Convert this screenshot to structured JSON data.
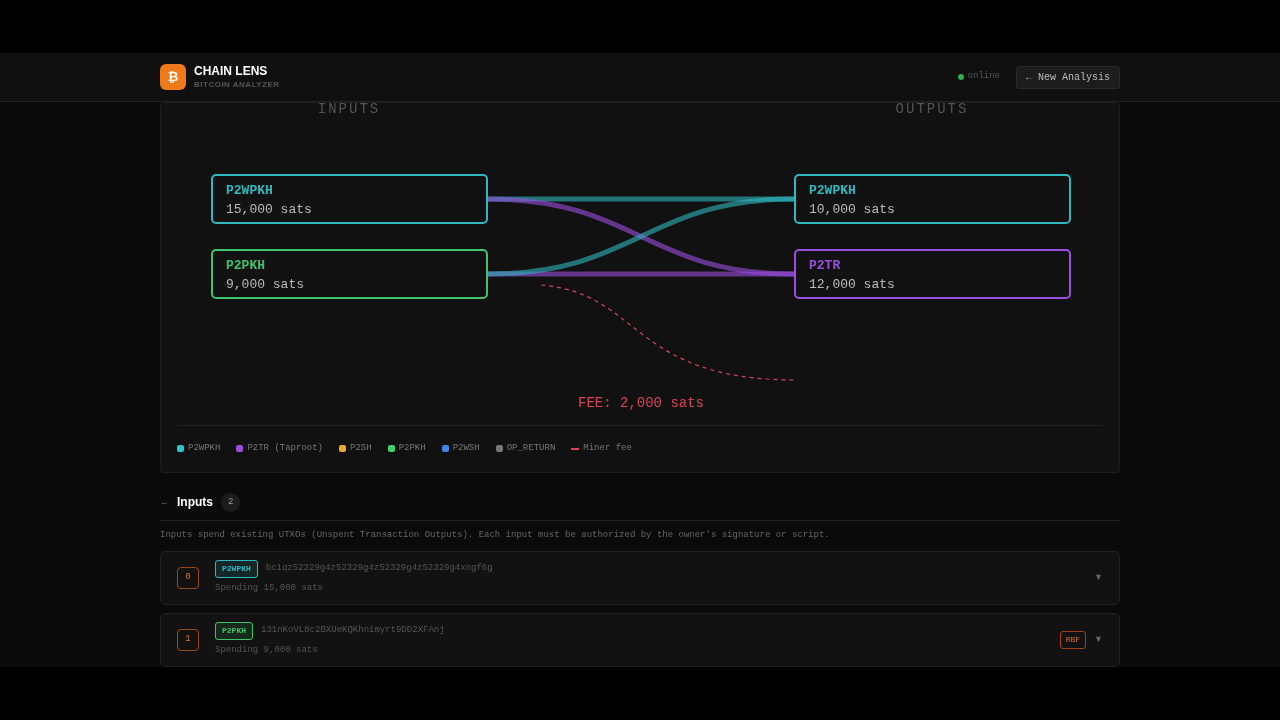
{
  "header": {
    "logo_glyph": "₿",
    "title": "CHAIN LENS",
    "subtitle": "BITCOIN ANALYZER",
    "status": {
      "label": "online",
      "online": true
    },
    "new_button": "← New Analysis"
  },
  "diagram": {
    "inputs_label": "INPUTS",
    "outputs_label": "OUTPUTS",
    "inputs": [
      {
        "type": "P2WPKH",
        "amount": "15,000 sats",
        "color": "#2fb8c0"
      },
      {
        "type": "P2PKH",
        "amount": "9,000 sats",
        "color": "#3fc46a"
      }
    ],
    "outputs": [
      {
        "type": "P2WPKH",
        "amount": "10,000 sats",
        "color": "#2fb8c0"
      },
      {
        "type": "P2TR",
        "amount": "12,000 sats",
        "color": "#9b4fe0"
      }
    ],
    "fee_label": "FEE: 2,000 sats",
    "legend": [
      {
        "label": "P2WPKH",
        "color": "#2ec4cc",
        "kind": "swatch"
      },
      {
        "label": "P2TR (Taproot)",
        "color": "#9b4fe0",
        "kind": "swatch"
      },
      {
        "label": "P2SH",
        "color": "#f0a830",
        "kind": "swatch"
      },
      {
        "label": "P2PKH",
        "color": "#3fd070",
        "kind": "swatch"
      },
      {
        "label": "P2WSH",
        "color": "#3f86e8",
        "kind": "swatch"
      },
      {
        "label": "OP_RETURN",
        "color": "#777777",
        "kind": "swatch"
      },
      {
        "label": "Miner fee",
        "color": "#d9435a",
        "kind": "line"
      }
    ]
  },
  "inputs_section": {
    "toggle": "←",
    "title": "Inputs",
    "count": "2",
    "description": "Inputs spend existing UTXOs (Unspent Transaction Outputs). Each input must be authorized by the owner's signature or script.",
    "items": [
      {
        "index": "0",
        "type": "P2WPKH",
        "color": "#2fb8c0",
        "address": "bc1qz52329g4z52329g4z52329g4z52329g4xngf6g",
        "spending": "Spending 15,000 sats",
        "chevron": "▼"
      },
      {
        "index": "1",
        "type": "P2PKH",
        "color": "#3fc46a",
        "address": "131nKoVL8c2BXUeKQKhnimyrt9DD2XFAnj",
        "spending": "Spending 9,000 sats",
        "rbf": "RBF",
        "chevron": "▼"
      }
    ]
  }
}
